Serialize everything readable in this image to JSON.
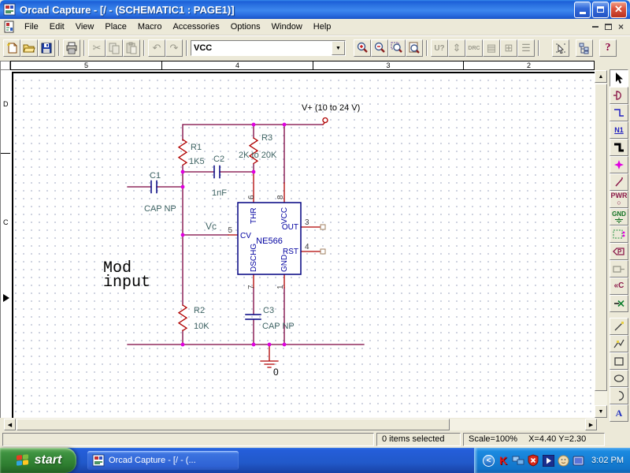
{
  "window": {
    "title": "Orcad Capture - [/ - (SCHEMATIC1 : PAGE1)]"
  },
  "menu": {
    "items": [
      "File",
      "Edit",
      "View",
      "Place",
      "Macro",
      "Accessories",
      "Options",
      "Window",
      "Help"
    ]
  },
  "toolbar": {
    "combo_value": "VCC",
    "annotate_label": "U?",
    "drc_label": "DRC",
    "help_label": "?",
    "buttons": [
      "new-document",
      "open-document",
      "save-document",
      "print",
      "cut",
      "copy",
      "paste",
      "undo",
      "redo",
      "zoom-in",
      "zoom-out",
      "zoom-area",
      "zoom-all",
      "annotate",
      "update-properties",
      "design-rules-check",
      "create-netlist",
      "cross-reference",
      "bill-of-materials",
      "snap-to-grid",
      "project-manager",
      "help"
    ]
  },
  "ruler": {
    "top": [
      "5",
      "4",
      "3",
      "2"
    ],
    "left": [
      "D",
      "C"
    ]
  },
  "palette": {
    "tools": [
      "select",
      "place-part",
      "place-wire",
      "place-net-alias",
      "place-bus",
      "place-junction",
      "place-bus-entry",
      "place-power",
      "place-ground",
      "place-hierarchical-block",
      "place-hierarchical-port",
      "place-hierarchical-pin",
      "place-off-page-connector",
      "place-no-connect",
      "place-line",
      "place-polyline",
      "place-rectangle",
      "place-ellipse",
      "place-arc",
      "place-text"
    ],
    "net_alias_label": "N1",
    "power_label": "PWR",
    "ground_label": "GND",
    "port_label": "P",
    "off_page_label": "«C",
    "text_label": "A"
  },
  "schematic": {
    "power_net": "V+ (10 to 24 V)",
    "annotation_line1": "Mod",
    "annotation_line2": "input",
    "vc_label": "Vc",
    "ground_label": "0",
    "ic": {
      "value": "NE566",
      "pin_names": {
        "thr": "THR",
        "vcc": "VCC",
        "cv": "CV",
        "out": "OUT",
        "dschg": "DSCHG",
        "rst": "RST",
        "gnd": "GND"
      },
      "pin_numbers": {
        "p1": "1",
        "p3": "3",
        "p4": "4",
        "p5": "5",
        "p6": "6",
        "p7": "7",
        "p8": "8"
      }
    },
    "parts": {
      "r1_ref": "R1",
      "r1_val": "1K5",
      "r2_ref": "R2",
      "r2_val": "10K",
      "r3_ref": "R3",
      "r3_val": "2K to 20K",
      "c1_ref": "C1",
      "c1_val": "CAP NP",
      "c2_ref": "C2",
      "c2_val": "1nF",
      "c3_ref": "C3",
      "c3_val": "CAP NP"
    },
    "colors": {
      "wire": "#7b003e",
      "part_graphics": "#b00000",
      "device_body": "#000080",
      "junction": "#e000e0",
      "label_text": "#3e6363"
    }
  },
  "statusbar": {
    "selection": "0 items selected",
    "scale": "Scale=100%",
    "coords": "X=4.40 Y=2.30"
  },
  "taskbar": {
    "start_label": "start",
    "task_label": "Orcad Capture - [/ - (...",
    "clock": "3:02 PM",
    "tray_icons": [
      "hide-chevron",
      "kaspersky",
      "network",
      "security-alert",
      "media-player",
      "messenger",
      "display"
    ]
  }
}
